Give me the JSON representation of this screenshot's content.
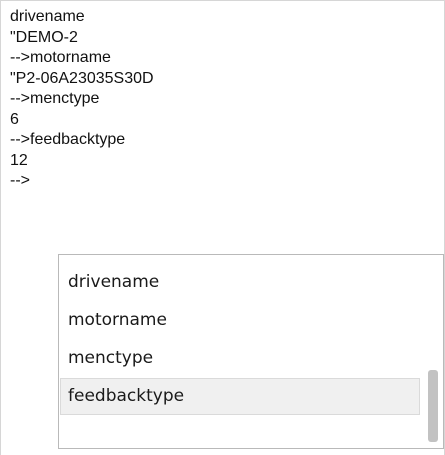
{
  "terminal": {
    "lines": [
      "drivename",
      "\"DEMO-2",
      "-->motorname",
      "\"P2-06A23035S30D",
      "-->menctype",
      "6",
      "-->feedbacktype",
      "12",
      "-->"
    ]
  },
  "autocomplete": {
    "items": [
      "drivename",
      "motorname",
      "menctype",
      "feedbacktype"
    ],
    "selected": "feedbacktype"
  }
}
